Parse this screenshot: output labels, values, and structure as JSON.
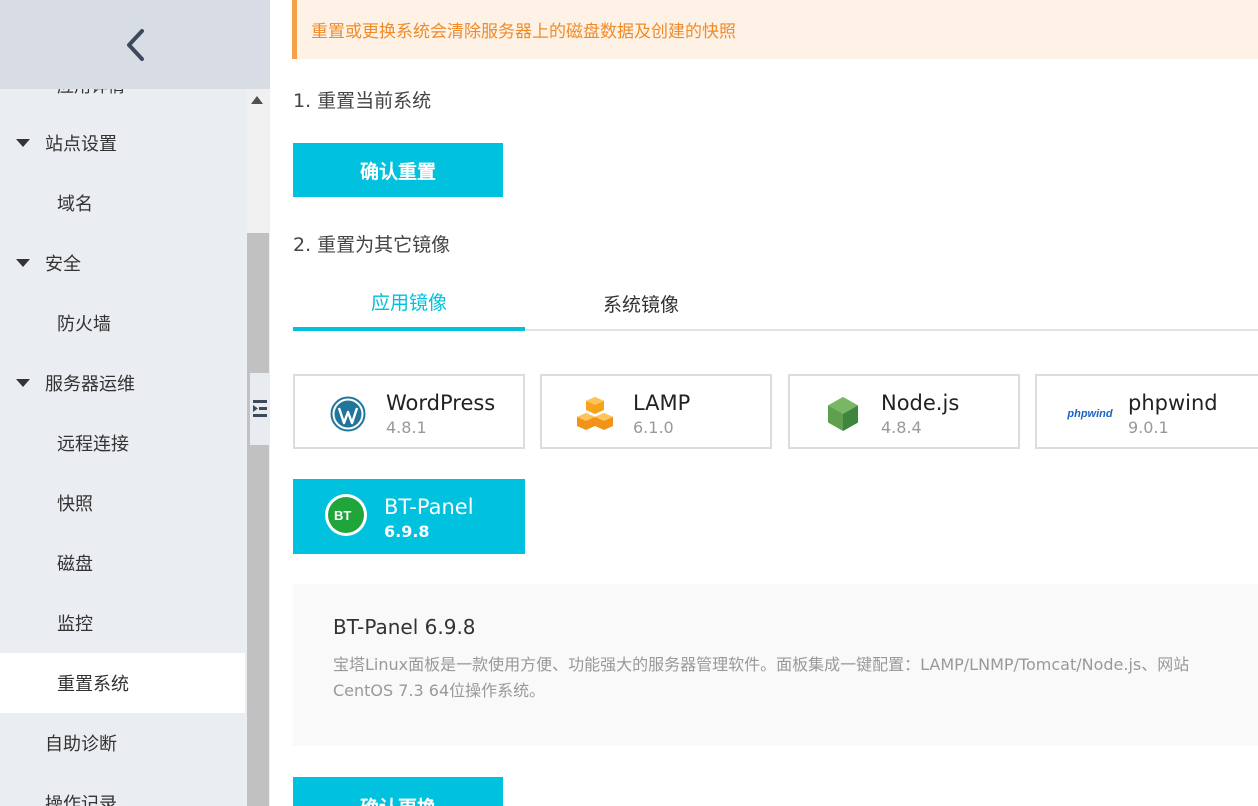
{
  "sidebar": {
    "partial_item": "应用详情",
    "items": [
      {
        "label": "站点设置",
        "kind": "group"
      },
      {
        "label": "域名",
        "kind": "sub"
      },
      {
        "label": "安全",
        "kind": "group"
      },
      {
        "label": "防火墙",
        "kind": "sub"
      },
      {
        "label": "服务器运维",
        "kind": "group"
      },
      {
        "label": "远程连接",
        "kind": "sub"
      },
      {
        "label": "快照",
        "kind": "sub"
      },
      {
        "label": "磁盘",
        "kind": "sub"
      },
      {
        "label": "监控",
        "kind": "sub"
      },
      {
        "label": "重置系统",
        "kind": "sub",
        "active": true
      },
      {
        "label": "自助诊断",
        "kind": "top"
      },
      {
        "label": "操作记录",
        "kind": "top"
      }
    ]
  },
  "notice": {
    "text": "重置或更换系统会清除服务器上的磁盘数据及创建的快照"
  },
  "section1": {
    "title": "1. 重置当前系统",
    "button": "确认重置"
  },
  "section2": {
    "title": "2. 重置为其它镜像",
    "tabs": [
      {
        "label": "应用镜像",
        "active": true
      },
      {
        "label": "系统镜像",
        "active": false
      }
    ],
    "images": [
      {
        "name": "WordPress",
        "version": "4.8.1",
        "icon": "wordpress-logo"
      },
      {
        "name": "LAMP",
        "version": "6.1.0",
        "icon": "lamp-logo"
      },
      {
        "name": "Node.js",
        "version": "4.8.4",
        "icon": "nodejs-logo"
      },
      {
        "name": "phpwind",
        "version": "9.0.1",
        "icon": "phpwind-logo",
        "logo_text": "phpwind"
      },
      {
        "name": "BT-Panel",
        "version": "6.9.8",
        "icon": "bt-panel-logo",
        "logo_text": "BT",
        "selected": true
      }
    ],
    "detail": {
      "title": "BT-Panel 6.9.8",
      "line1": "宝塔Linux面板是一款使用方便、功能强大的服务器管理软件。面板集成一键配置：LAMP/LNMP/Tomcat/Node.js、网站",
      "line2": "CentOS 7.3 64位操作系统。"
    },
    "confirm_button": "确认更换"
  },
  "colors": {
    "accent": "#00c1de",
    "notice_bg": "#fdf2e5",
    "notice_text": "#f08b2a",
    "sidebar_bg": "#eaedf1"
  }
}
